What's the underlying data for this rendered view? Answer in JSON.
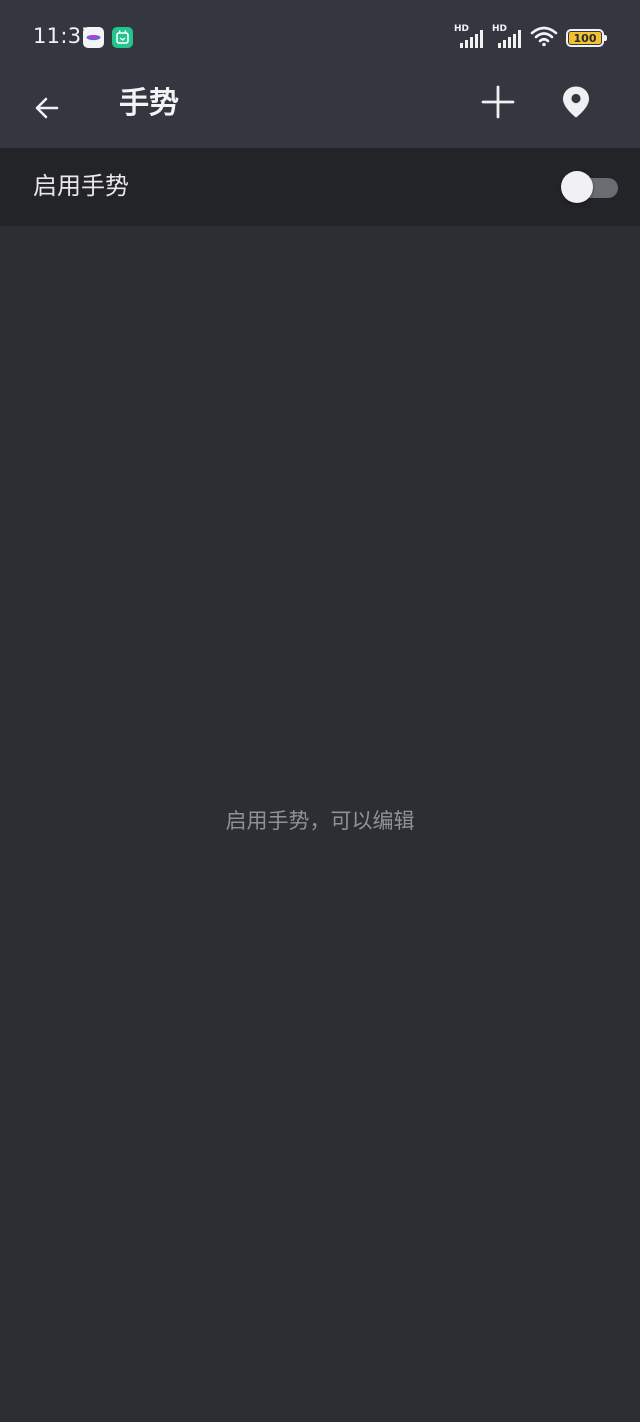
{
  "status_bar": {
    "time": "11:37",
    "notification_icons": [
      "app-notification-icon",
      "mi-home-icon"
    ],
    "signal_1_label": "HD",
    "signal_2_label": "HD",
    "battery_level": "100"
  },
  "toolbar": {
    "title": "手势",
    "back_icon": "arrow-left-icon",
    "add_icon": "plus-icon",
    "location_icon": "location-pin-icon"
  },
  "enable_row": {
    "label": "启用手势",
    "toggle_on": false
  },
  "content": {
    "empty_hint": "启用手势，可以编辑"
  },
  "colors": {
    "background": "#2b2e33",
    "header": "#353740",
    "row": "#232428",
    "battery": "#f1c232"
  }
}
